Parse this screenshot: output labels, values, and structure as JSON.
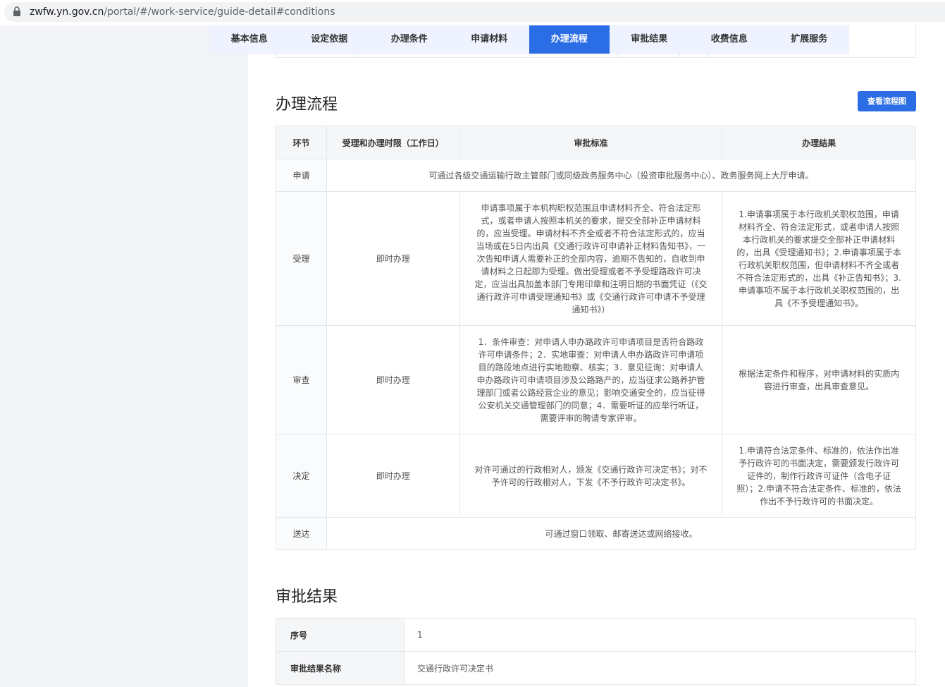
{
  "browser": {
    "url_host": "zwfw.yn.gov.cn",
    "url_path": "/portal/#/work-service/guide-detail#conditions"
  },
  "tabs": [
    {
      "label": "基本信息",
      "active": false
    },
    {
      "label": "设定依据",
      "active": false
    },
    {
      "label": "办理条件",
      "active": false
    },
    {
      "label": "申请材料",
      "active": false
    },
    {
      "label": "办理流程",
      "active": true
    },
    {
      "label": "审批结果",
      "active": false
    },
    {
      "label": "收费信息",
      "active": false
    },
    {
      "label": "扩展服务",
      "active": false
    }
  ],
  "flow": {
    "title": "办理流程",
    "view_button": "查看流程图",
    "headers": [
      "环节",
      "受理和办理时限（工作日）",
      "审批标准",
      "办理结果"
    ],
    "rows": [
      {
        "stage": "申请",
        "merged": "可通过各级交通运输行政主管部门或同级政务服务中心（投资审批服务中心）、政务服务网上大厅申请。"
      },
      {
        "stage": "受理",
        "limit": "即时办理",
        "standard": "申请事项属于本机构职权范围且申请材料齐全、符合法定形式，或者申请人按照本机关的要求，提交全部补正申请材料的，应当受理。申请材料不齐全或者不符合法定形式的，应当当场或在5日内出具《交通行政许可申请补正材料告知书》，一次告知申请人需要补正的全部内容，逾期不告知的，自收到申请材料之日起即为受理。做出受理或者不予受理路政许可决定，应当出具加盖本部门专用印章和注明日期的书面凭证（《交通行政许可申请受理通知书》或《交通行政许可申请不予受理通知书》）",
        "result": "1.申请事项属于本行政机关职权范围，申请材料齐全、符合法定形式，或者申请人按照本行政机关的要求提交全部补正申请材料的，出具《受理通知书》；2.申请事项属于本行政机关职权范围，但申请材料不齐全或者不符合法定形式的，出具《补正告知书》；3.申请事项不属于本行政机关职权范围的，出具《不予受理通知书》。"
      },
      {
        "stage": "审查",
        "limit": "即时办理",
        "standard": "1．条件审查：对申请人申办路政许可申请项目是否符合路政许可申请条件；2．实地审查：对申请人申办路政许可申请项目的路段地点进行实地勘察、核实；3．意见征询：对申请人申办路政许可申请项目涉及公路路产的，应当征求公路养护管理部门或者公路经营企业的意见；影响交通安全的，应当征得公安机关交通管理部门的同意；4．需要听证的应举行听证，需要评审的聘请专家评审。",
        "result": "根据法定条件和程序，对申请材料的实质内容进行审查，出具审查意见。"
      },
      {
        "stage": "决定",
        "limit": "即时办理",
        "standard": "对许可通过的行政相对人，颁发《交通行政许可决定书》；对不予许可的行政相对人，下发《不予行政许可决定书》。",
        "result": "1.申请符合法定条件、标准的，依法作出准予行政许可的书面决定，需要颁发行政许可证件的，制作行政许可证件（含电子证照）；2.申请不符合法定条件、标准的，依法作出不予行政许可的书面决定。"
      },
      {
        "stage": "送达",
        "merged": "可通过窗口领取、邮寄送达或网络接收。"
      }
    ]
  },
  "result_section": {
    "title": "审批结果",
    "rows": [
      {
        "key": "序号",
        "value": "1"
      },
      {
        "key": "审批结果名称",
        "value": "交通行政许可决定书"
      }
    ]
  },
  "colors": {
    "accent": "#2b6de5"
  }
}
